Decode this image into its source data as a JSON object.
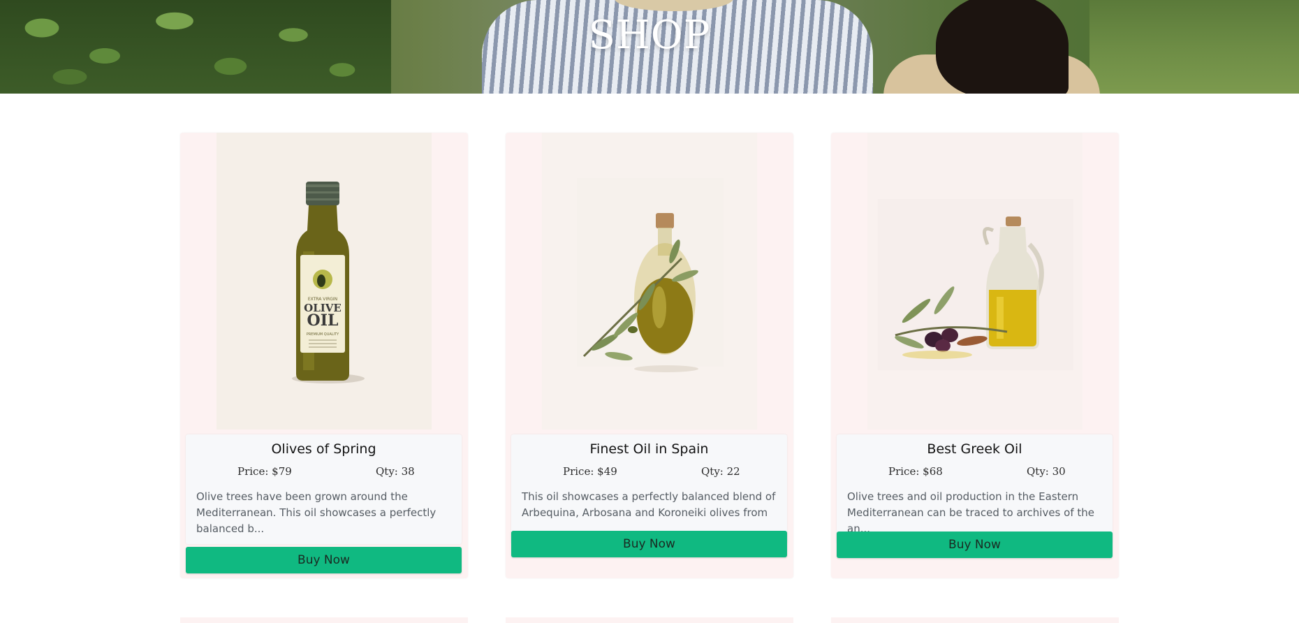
{
  "hero": {
    "title": "SHOP"
  },
  "products": [
    {
      "name": "Olives of Spring",
      "price": "Price: $79",
      "qty": "Qty: 38",
      "description": "Olive trees have been grown around the Mediterranean. This oil showcases a perfectly balanced b...",
      "button": "Buy Now",
      "label_lines": [
        "EXTRA VIRGIN",
        "OLIVE",
        "OIL",
        "PREMIUM QUALITY"
      ]
    },
    {
      "name": "Finest Oil in Spain",
      "price": "Price: $49",
      "qty": "Qty: 22",
      "description": "This oil showcases a perfectly balanced blend of Arbequina, Arbosana and Koroneiki olives from ...",
      "button": "Buy Now"
    },
    {
      "name": "Best Greek Oil",
      "price": "Price: $68",
      "qty": "Qty: 30",
      "description": "Olive trees and oil production in the Eastern Mediterranean can be traced to archives of the an...",
      "button": "Buy Now"
    }
  ],
  "colors": {
    "card_bg": "#fdf2f2",
    "info_bg": "#f7f8fa",
    "button": "#10b981"
  }
}
